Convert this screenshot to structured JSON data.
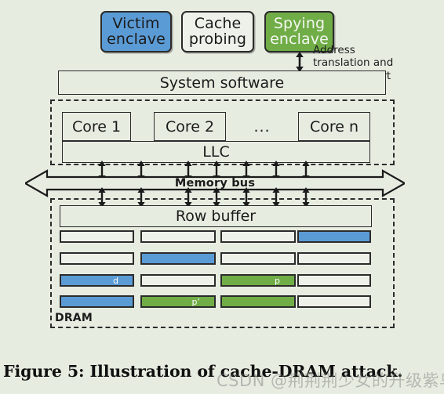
{
  "figure": {
    "caption": "Figure 5: Illustration of cache-DRAM attack.",
    "watermark": "CSDN @荆荆荆少女的升级紫鸟"
  },
  "colors": {
    "background": "#e7ece1",
    "blue": "#5b9bd5",
    "green": "#70ad47",
    "white_cell": "#eef1ea",
    "stroke": "#2b2b2b"
  },
  "top_boxes": [
    {
      "id": "victim-enclave",
      "line1": "Victim",
      "line2": "enclave",
      "fill": "blue"
    },
    {
      "id": "cache-probing",
      "line1": "Cache",
      "line2": "probing",
      "fill": "white"
    },
    {
      "id": "spying-enclave",
      "line1": "Spying",
      "line2": "enclave",
      "fill": "green"
    }
  ],
  "annotations": {
    "address_note_line1": "Address",
    "address_note_line2": "translation and",
    "address_note_line3": "timing support"
  },
  "system": {
    "system_software": "System software",
    "llc": "LLC",
    "memory_bus": "Memory bus",
    "row_buffer": "Row buffer",
    "dram_label": "DRAM"
  },
  "cores": {
    "core_1": "Core 1",
    "core_2": "Core 2",
    "ellipsis": "...",
    "core_n": "Core n"
  },
  "dram_grid": {
    "rows": [
      [
        {
          "fill": "white",
          "label": ""
        },
        {
          "fill": "white",
          "label": ""
        },
        {
          "fill": "white",
          "label": ""
        },
        {
          "fill": "blue",
          "label": ""
        }
      ],
      [
        {
          "fill": "white",
          "label": ""
        },
        {
          "fill": "blue",
          "label": ""
        },
        {
          "fill": "white",
          "label": ""
        },
        {
          "fill": "white",
          "label": ""
        }
      ],
      [
        {
          "fill": "blue",
          "label": "d"
        },
        {
          "fill": "white",
          "label": ""
        },
        {
          "fill": "green",
          "label": "p"
        },
        {
          "fill": "white",
          "label": ""
        }
      ],
      [
        {
          "fill": "blue",
          "label": ""
        },
        {
          "fill": "green",
          "label": "p’"
        },
        {
          "fill": "green",
          "label": ""
        },
        {
          "fill": "white",
          "label": ""
        }
      ]
    ]
  }
}
